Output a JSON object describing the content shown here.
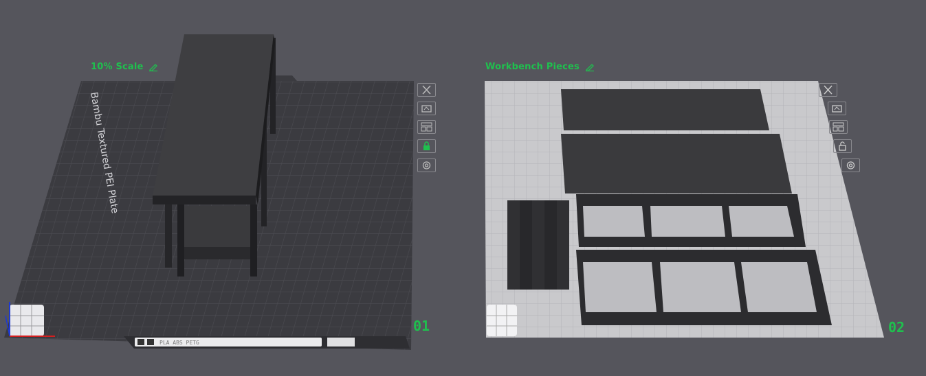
{
  "plates": [
    {
      "name": "10% Scale",
      "number": "01",
      "bed_label": "Bambu Textured PEI Plate",
      "status_strip": "PLA  ABS  PETG",
      "locked": true
    },
    {
      "name": "Workbench Pieces",
      "number": "02",
      "locked": false
    }
  ],
  "colors": {
    "accent": "#1fc04e",
    "background": "#55555c",
    "plate1": "#3b3b40",
    "plate2": "#c9c9cc"
  },
  "icons": [
    "close-icon",
    "auto-orient-icon",
    "arrange-icon",
    "lock-icon",
    "settings-icon"
  ]
}
